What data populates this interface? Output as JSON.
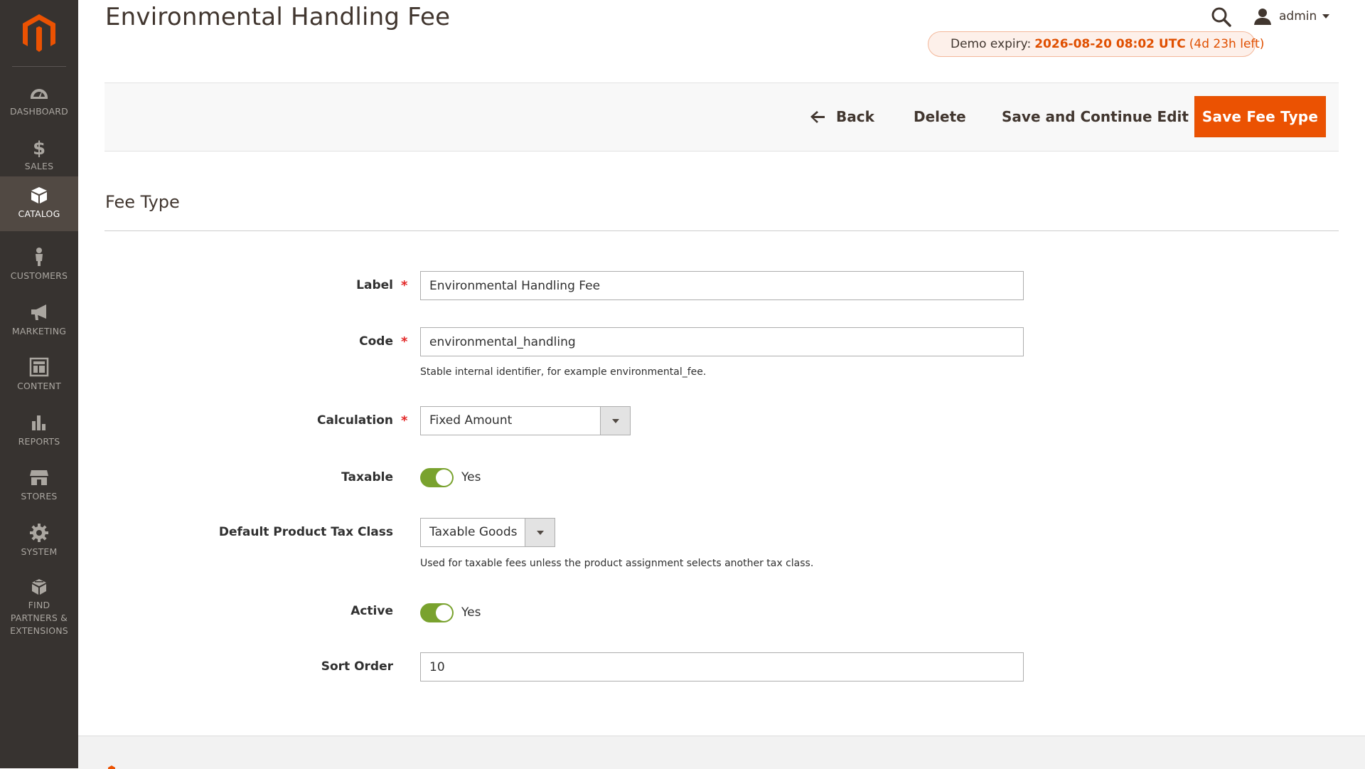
{
  "sidebar": {
    "items": [
      {
        "label": "DASHBOARD",
        "icon": "dashboard-icon"
      },
      {
        "label": "SALES",
        "icon": "dollar-icon"
      },
      {
        "label": "CATALOG",
        "icon": "box-icon",
        "active": true
      },
      {
        "label": "CUSTOMERS",
        "icon": "person-icon"
      },
      {
        "label": "MARKETING",
        "icon": "megaphone-icon"
      },
      {
        "label": "CONTENT",
        "icon": "layout-icon"
      },
      {
        "label": "REPORTS",
        "icon": "bar-chart-icon"
      },
      {
        "label": "STORES",
        "icon": "storefront-icon"
      },
      {
        "label": "SYSTEM",
        "icon": "gear-icon"
      },
      {
        "label": "FIND PARTNERS & EXTENSIONS",
        "icon": "boxes-icon"
      }
    ]
  },
  "header": {
    "title": "Environmental Handling Fee",
    "user": "admin",
    "banner": {
      "label": "Demo expiry:",
      "value": "2026-08-20 08:02 UTC",
      "remaining": "(4d 23h left)"
    }
  },
  "actions": {
    "back": "Back",
    "delete": "Delete",
    "save_continue": "Save and Continue Edit",
    "save": "Save Fee Type"
  },
  "section": {
    "title": "Fee Type"
  },
  "form": {
    "label": {
      "label": "Label",
      "value": "Environmental Handling Fee"
    },
    "code": {
      "label": "Code",
      "value": "environmental_handling",
      "note": "Stable internal identifier, for example environmental_fee."
    },
    "calculation": {
      "label": "Calculation",
      "value": "Fixed Amount"
    },
    "taxable": {
      "label": "Taxable",
      "state": "Yes"
    },
    "tax_class": {
      "label": "Default Product Tax Class",
      "value": "Taxable Goods",
      "note": "Used for taxable fees unless the product assignment selects another tax class."
    },
    "active": {
      "label": "Active",
      "state": "Yes"
    },
    "sort_order": {
      "label": "Sort Order",
      "value": "10"
    }
  },
  "colors": {
    "accent": "#eb5202",
    "sidebar": "#373330",
    "toggle_on": "#79a22e",
    "required": "#e22626"
  }
}
